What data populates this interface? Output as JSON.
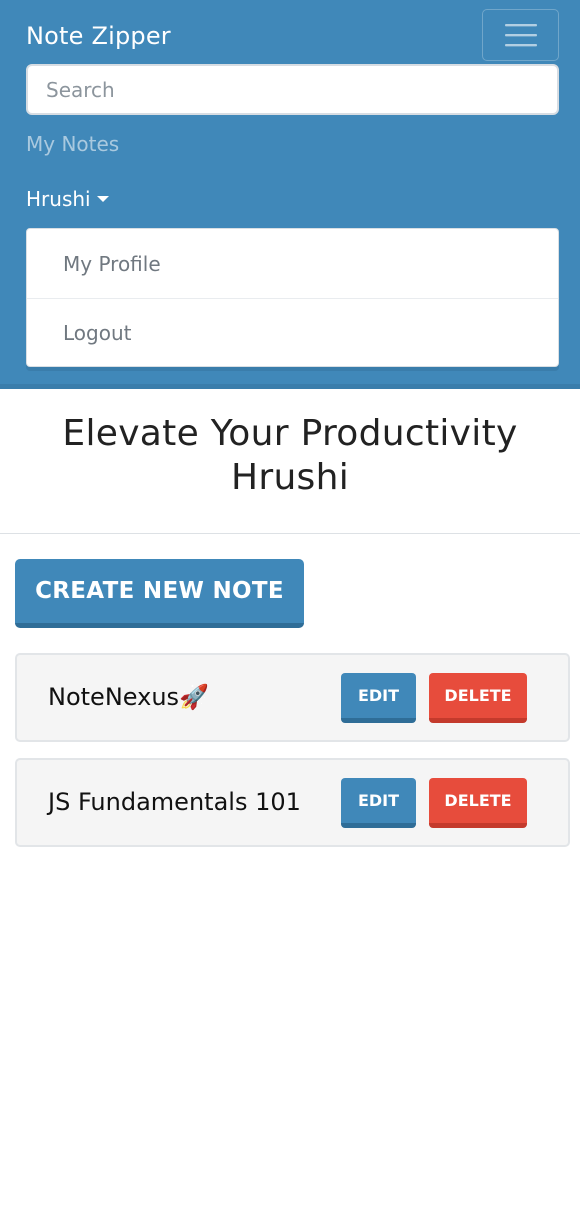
{
  "header": {
    "brand": "Note Zipper",
    "menu_icon": "hamburger-menu-icon",
    "search_placeholder": "Search",
    "search_value": "",
    "my_notes_link": "My Notes",
    "user_menu": {
      "username": "Hrushi",
      "items": [
        {
          "label": "My Profile"
        },
        {
          "label": "Logout"
        }
      ]
    }
  },
  "main": {
    "heading_line1": "Elevate Your Productivity",
    "heading_line2": "Hrushi",
    "create_button": "CREATE NEW NOTE",
    "notes": [
      {
        "title": "NoteNexus🚀",
        "edit_label": "EDIT",
        "delete_label": "DELETE"
      },
      {
        "title": "JS Fundamentals 101",
        "edit_label": "EDIT",
        "delete_label": "DELETE"
      }
    ]
  },
  "colors": {
    "primary": "#4088b9",
    "danger": "#e74c3c",
    "card_bg": "#f5f5f5"
  }
}
